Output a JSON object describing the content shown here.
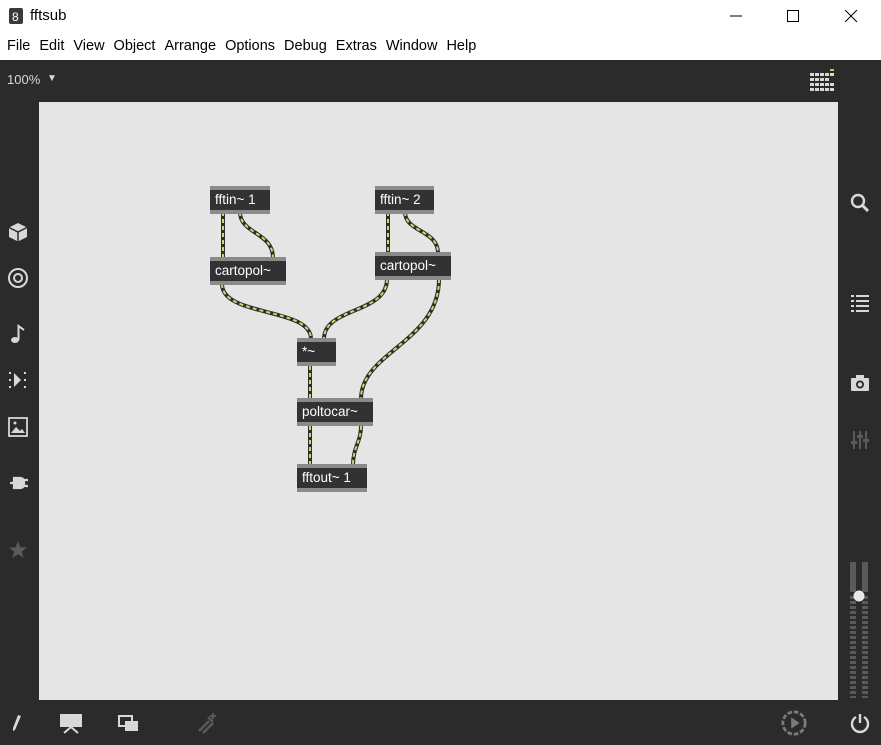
{
  "window": {
    "title": "fftsub",
    "app_icon": "max-app-icon",
    "controls": [
      "minimize-icon",
      "maximize-icon",
      "close-icon"
    ]
  },
  "menu": [
    "File",
    "Edit",
    "View",
    "Object",
    "Arrange",
    "Options",
    "Debug",
    "Extras",
    "Window",
    "Help"
  ],
  "toolbar": {
    "zoom": "100%",
    "zoom_arrow": "▼",
    "grid_icon": "presentation-grid-icon"
  },
  "left_sidebar_icons": [
    "cube-icon",
    "target-icon",
    "music-note-icon",
    "step-forward-icon",
    "image-icon",
    "plug-icon",
    "star-icon"
  ],
  "right_sidebar_icons": [
    "search-icon",
    "list-icon",
    "camera-icon",
    "mixer-icon"
  ],
  "patch": {
    "objects": {
      "fftin1": "fftin~ 1",
      "fftin2": "fftin~ 2",
      "cartopol1": "cartopol~",
      "cartopol2": "cartopol~",
      "mult": "*~",
      "poltocar": "poltocar~",
      "fftout": "fftout~ 1"
    },
    "cable_color": "#c9d96e"
  },
  "bottom_icons": [
    "pencil-icon",
    "presentation-icon",
    "windows-icon",
    "attach-icon",
    "play-circle-icon",
    "power-icon"
  ],
  "volume_level": 0.5
}
